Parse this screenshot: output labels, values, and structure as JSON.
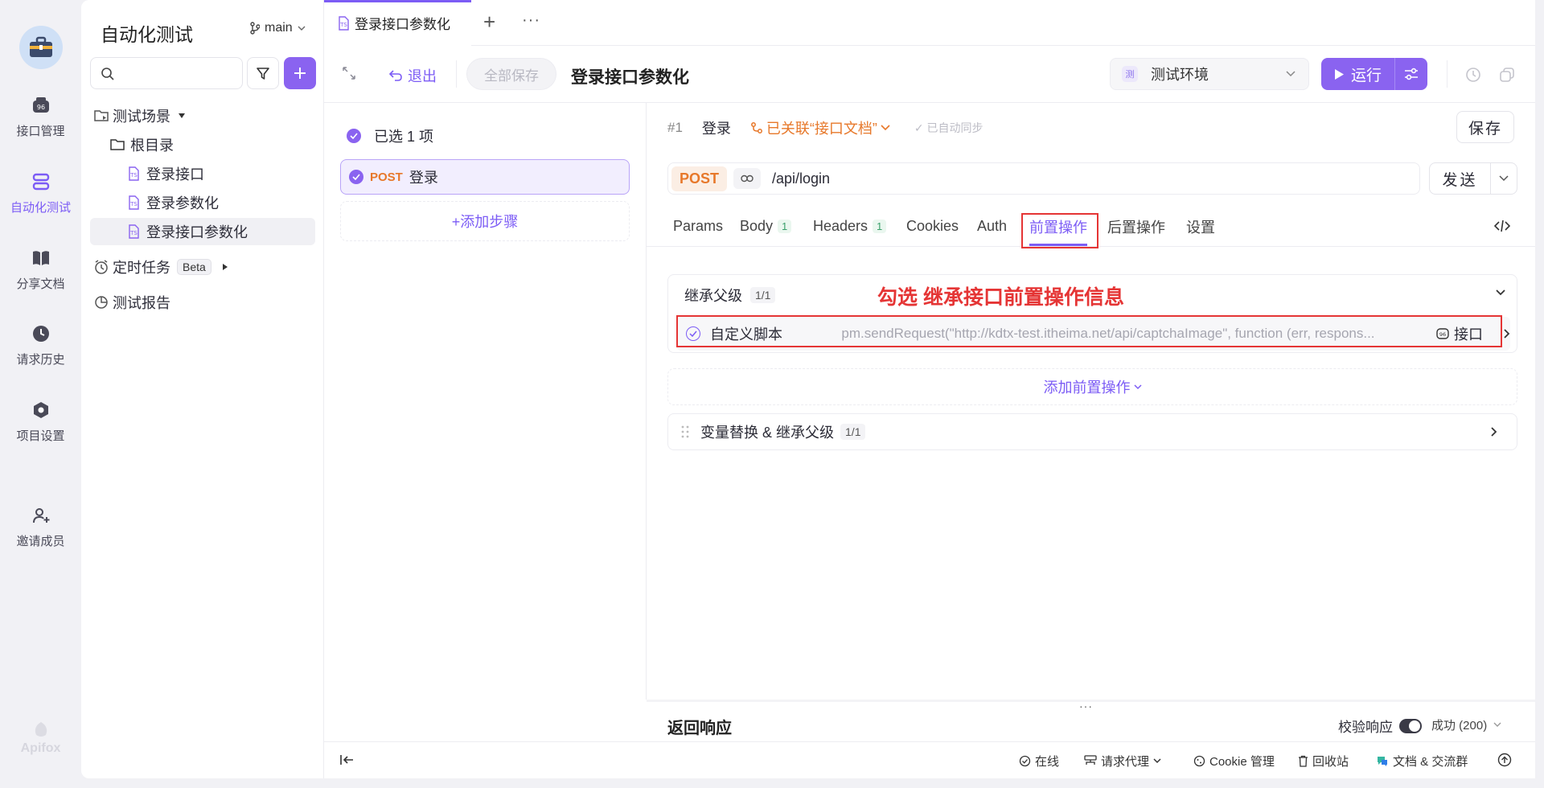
{
  "rail": {
    "items": [
      {
        "label": "接口管理",
        "icon": "api-icon"
      },
      {
        "label": "自动化测试",
        "icon": "automation-icon"
      },
      {
        "label": "分享文档",
        "icon": "book-icon"
      },
      {
        "label": "请求历史",
        "icon": "clock-icon"
      },
      {
        "label": "项目设置",
        "icon": "settings-hex-icon"
      },
      {
        "label": "邀请成员",
        "icon": "user-plus-icon"
      }
    ],
    "brand": "Apifox"
  },
  "sidebar": {
    "project_title": "自动化测试",
    "branch": "main",
    "search_placeholder": "",
    "tree": {
      "scenes": "测试场景",
      "root": "根目录",
      "items": [
        "登录接口",
        "登录参数化",
        "登录接口参数化"
      ],
      "scheduled": "定时任务",
      "beta": "Beta",
      "report": "测试报告"
    }
  },
  "tabbar": {
    "active_tab": "登录接口参数化",
    "add": "+",
    "more": "···"
  },
  "toolbar": {
    "exit": "退出",
    "save_all": "全部保存",
    "title": "登录接口参数化",
    "env_badge": "测",
    "env": "测试环境",
    "run": "运行"
  },
  "steps": {
    "selected": "已选 1 项",
    "step_method": "POST",
    "step_name": "登录",
    "add_step": "+添加步骤"
  },
  "detail": {
    "index": "#1",
    "name": "登录",
    "linked": "已关联“接口文档”",
    "auto_sync": "✓ 已自动同步",
    "save": "保存",
    "method": "POST",
    "url": "/api/login",
    "send": "发送",
    "tabs": [
      {
        "label": "Params"
      },
      {
        "label": "Body",
        "count": "1"
      },
      {
        "label": "Headers",
        "count": "1"
      },
      {
        "label": "Cookies"
      },
      {
        "label": "Auth"
      },
      {
        "label": "前置操作"
      },
      {
        "label": "后置操作"
      },
      {
        "label": "设置"
      }
    ],
    "inherit_label": "继承父级",
    "inherit_count": "1/1",
    "annotation": "勾选 继承接口前置操作信息",
    "script_name": "自定义脚本",
    "script_code": "pm.sendRequest(\"http://kdtx-test.itheima.net/api/captchaImage\", function (err, respons...",
    "script_source": "接口",
    "add_pre_op": "添加前置操作",
    "var_replace": "变量替换 & 继承父级",
    "var_count": "1/1"
  },
  "response": {
    "title": "返回响应",
    "validate": "校验响应",
    "status": "成功 (200)"
  },
  "statusbar": {
    "online": "在线",
    "proxy": "请求代理",
    "cookie": "Cookie 管理",
    "trash": "回收站",
    "docs": "文档 & 交流群"
  },
  "colors": {
    "accent": "#8a63f0",
    "post": "#e7782a",
    "annotation": "#e53535"
  }
}
